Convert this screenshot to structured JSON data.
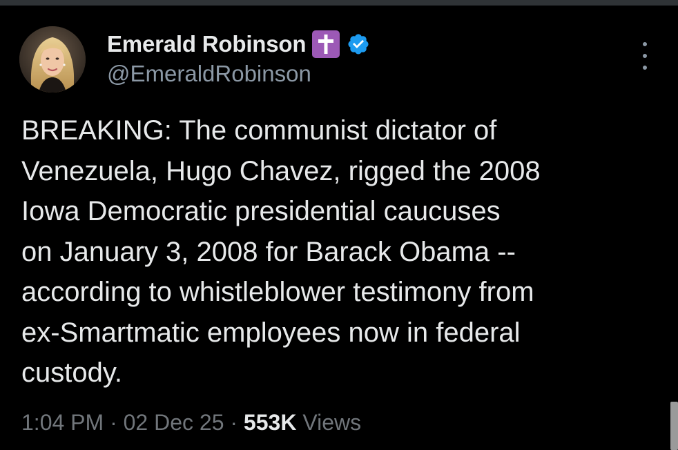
{
  "author": {
    "display_name": "Emerald Robinson",
    "handle": "@EmeraldRobinson",
    "badge_icon": "latin-cross-icon",
    "verified_icon": "verified-check-icon",
    "badge_color": "#9c59b6",
    "verified_color": "#1d9bf0"
  },
  "tweet": {
    "lines": [
      "BREAKING: The communist dictator of",
      "Venezuela, Hugo Chavez, rigged the 2008",
      "Iowa Democratic presidential caucuses",
      "on January 3, 2008 for Barack Obama --",
      "according to whistleblower testimony from",
      "ex-Smartmatic employees now in federal",
      "custody."
    ]
  },
  "meta": {
    "time": "1:04 PM",
    "separator": "·",
    "date": "02 Dec 25",
    "views_count": "553K",
    "views_label": "Views"
  },
  "icons": {
    "more": "more-options-icon"
  }
}
